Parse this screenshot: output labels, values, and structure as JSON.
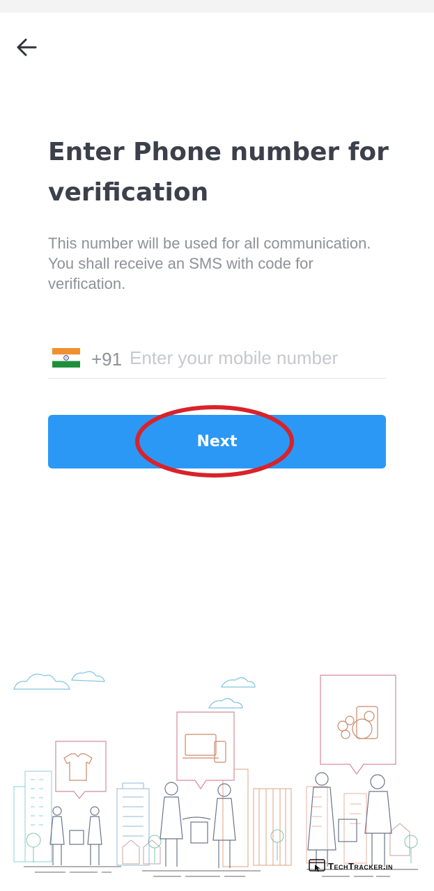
{
  "header": {
    "back_icon": "arrow-left-icon"
  },
  "content": {
    "title": "Enter Phone number for verification",
    "subtitle": "This number will be used for all communication. You shall receive an SMS with code for verification."
  },
  "phone": {
    "flag_icon": "india-flag-icon",
    "country_code": "+91",
    "placeholder": "Enter your mobile number",
    "value": ""
  },
  "actions": {
    "next_label": "Next"
  },
  "annotation": {
    "highlight_color": "#d9222a"
  },
  "illustration": {
    "icons": [
      "clothes-icon",
      "laptop-phone-icon",
      "grocery-icon"
    ]
  },
  "watermark": {
    "text": "TechTracker.in"
  },
  "colors": {
    "accent": "#2b98f5",
    "title": "#3c404b",
    "muted": "#8e9196"
  }
}
